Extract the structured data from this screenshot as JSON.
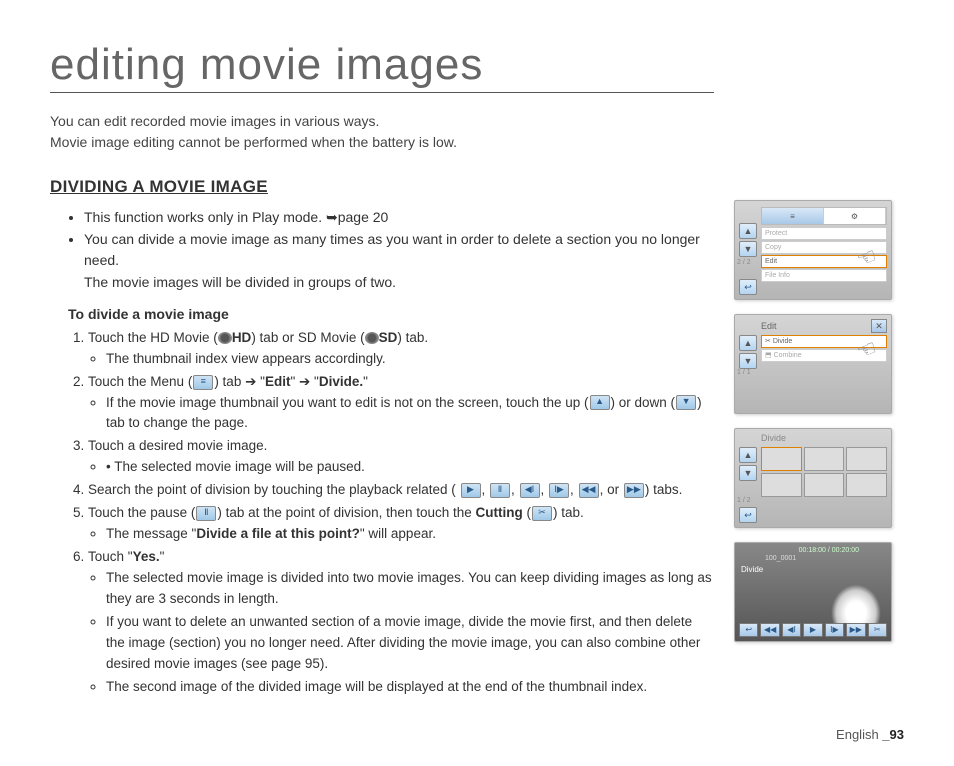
{
  "title": "editing movie images",
  "intro1": "You can edit recorded movie images in various ways.",
  "intro2": "Movie image editing cannot be performed when the battery is low.",
  "section_heading": "DIVIDING A MOVIE IMAGE",
  "bullets": [
    "This function works only in Play mode. ➥page 20",
    "You can divide a movie image as many times as you want in order to delete a section you no longer need.",
    "The movie images will be divided in groups of two."
  ],
  "sub_heading": "To divide a movie image",
  "steps": {
    "s1a": "Touch the HD Movie (",
    "s1_hd": "HD",
    "s1b": ") tab or SD Movie (",
    "s1_sd": "SD",
    "s1c": ") tab.",
    "s1_sub": "The thumbnail index view appears accordingly.",
    "s2a": "Touch the Menu (",
    "s2b": ") tab ➔ \"",
    "s2_edit": "Edit",
    "s2c": "\" ➔ \"",
    "s2_divide": "Divide.",
    "s2d": "\"",
    "s2_sub1a": "If the movie image thumbnail you want to edit is not on the screen, touch the up (",
    "s2_sub1b": ") or down (",
    "s2_sub1c": ") tab to change the page.",
    "s3": "Touch a desired movie image.",
    "s3_sub": "The selected movie image will be paused.",
    "s4a": "Search the point of division by touching the playback related (",
    "s4b": ", ",
    "s4c": ", or ",
    "s4d": ") tabs.",
    "s5a": "Touch the pause (",
    "s5b": ")  tab at the point of division, then touch the ",
    "s5_cutting": "Cutting",
    "s5c": " (",
    "s5d": ") tab.",
    "s5_sub_a": "The message \"",
    "s5_sub_msg": "Divide a file at this point?",
    "s5_sub_b": "\" will appear.",
    "s6a": "Touch \"",
    "s6_yes": "Yes.",
    "s6b": "\"",
    "s6_sub1": "The selected movie image is divided into two movie images. You can keep dividing images as long as they are 3 seconds in length.",
    "s6_sub2": "If you want to delete an unwanted section of a movie image, divide the movie first, and then delete the image (section) you no longer need. After dividing the movie image, you can also combine other desired movie images (see page 95).",
    "s6_sub3": "The second image of the divided image will be displayed at the end of the thumbnail index."
  },
  "footer": {
    "lang": "English ",
    "page": "_93"
  },
  "screens": {
    "s1": {
      "tabs": [
        "≡",
        "⚙"
      ],
      "menu": [
        "Protect",
        "Copy",
        "Edit",
        "File Info"
      ],
      "counter": "2 / 2"
    },
    "s2": {
      "title": "Edit",
      "opts": [
        "Divide",
        "Combine"
      ],
      "counter": "1 / 1"
    },
    "s3": {
      "title": "Divide",
      "counter": "1 / 2"
    },
    "s4": {
      "time": "00:18:00 / 00:20:00",
      "file": "100_0001",
      "label": "Divide",
      "btns": [
        "↩",
        "◀◀",
        "◀Ⅰ",
        "▶",
        "Ⅰ▶",
        "▶▶",
        "✂"
      ]
    }
  }
}
